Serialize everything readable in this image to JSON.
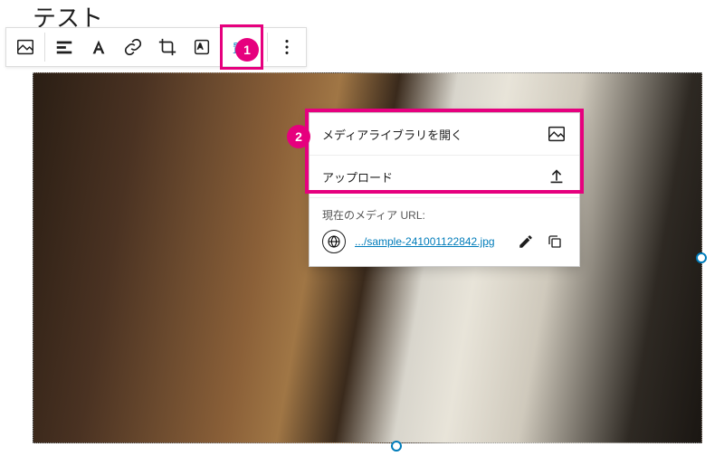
{
  "page": {
    "title_fragment": "テスト"
  },
  "toolbar": {
    "replace_label": "置換",
    "icons": {
      "image": "image-icon",
      "align": "align-icon",
      "text_overlay": "text-overlay-icon",
      "link": "link-icon",
      "crop": "crop-icon",
      "duotone": "duotone-icon",
      "more": "more-icon"
    }
  },
  "dropdown": {
    "open_media_library": "メディアライブラリを開く",
    "upload": "アップロード",
    "current_media_label": "現在のメディア URL:",
    "url_text": ".../sample-241001122842.jpg"
  },
  "badges": {
    "one": "1",
    "two": "2"
  },
  "colors": {
    "accent": "#e6007e",
    "link": "#007cba"
  }
}
